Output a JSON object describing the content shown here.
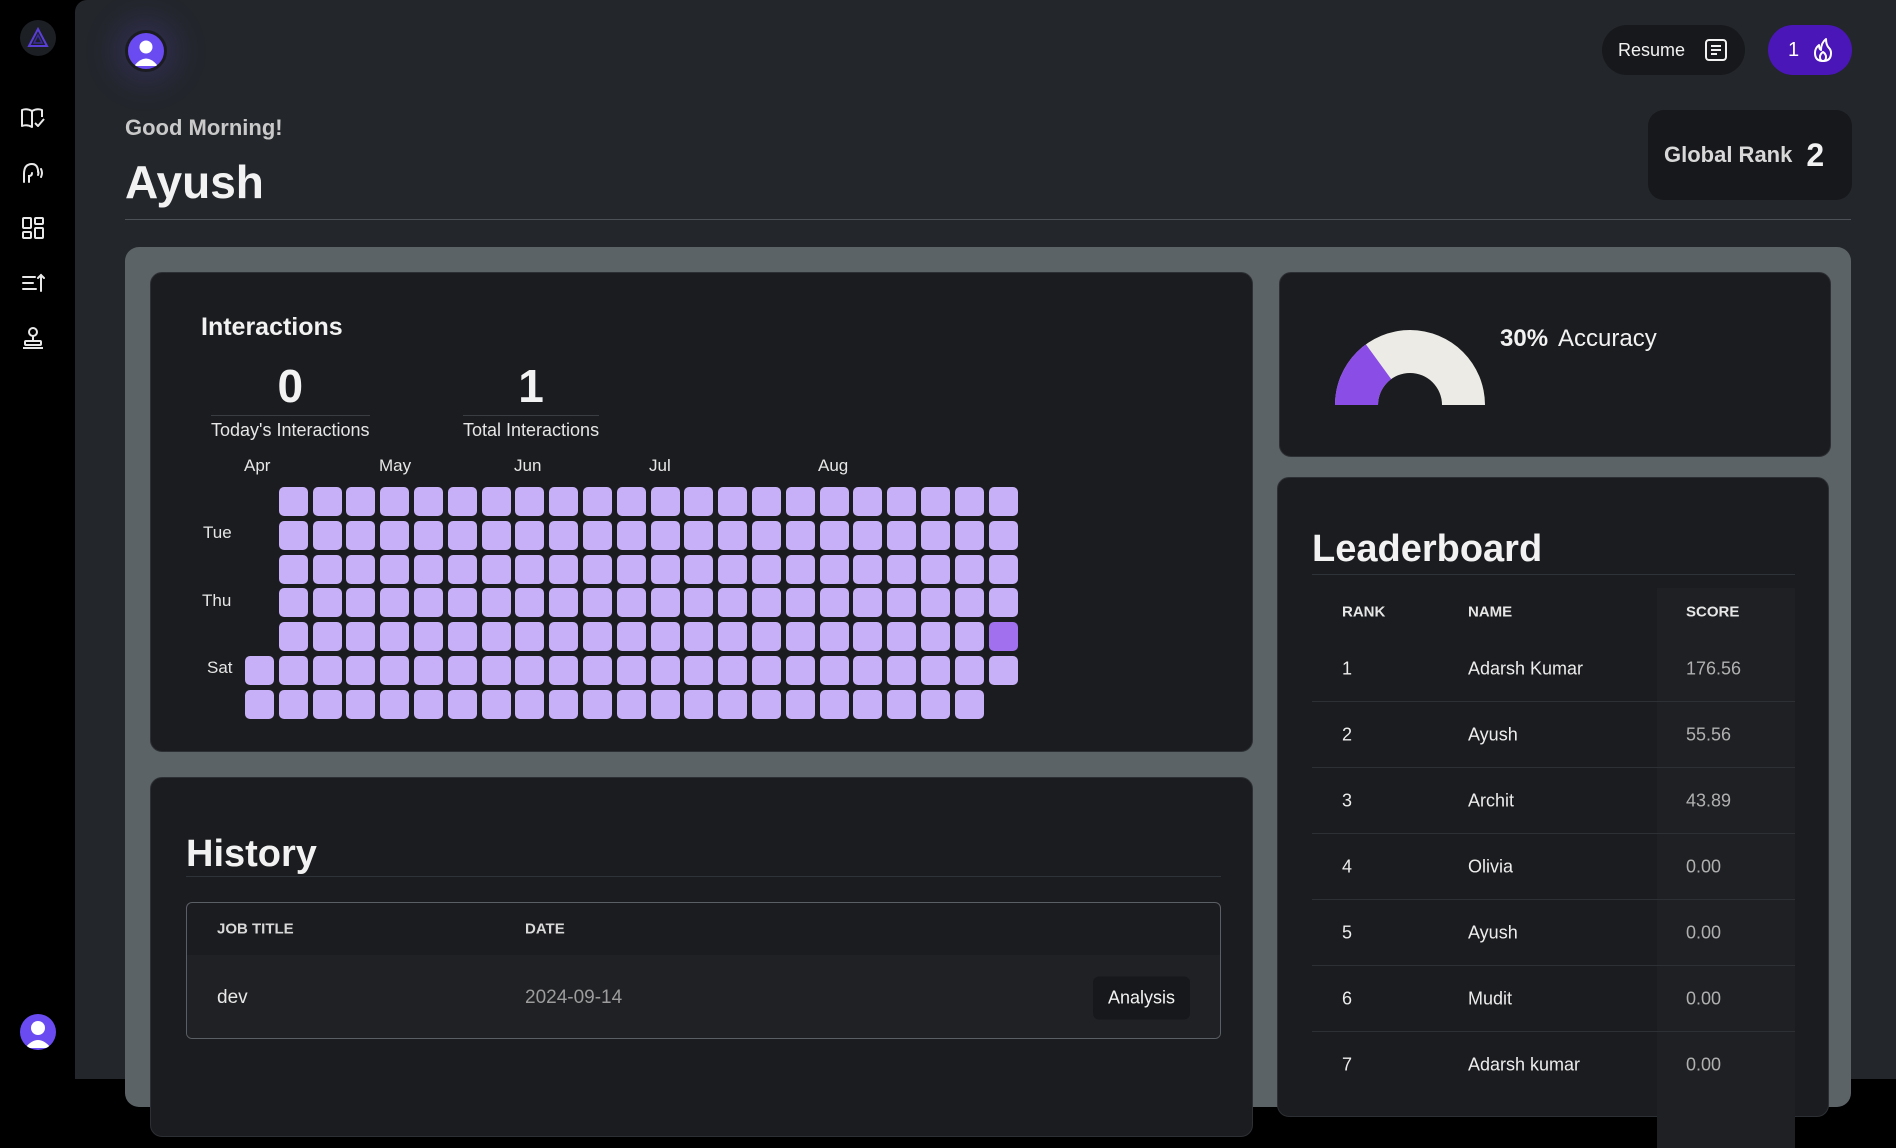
{
  "sidebar": {
    "logo_icon": "triangle-logo-icon",
    "items": [
      {
        "icon": "book-check-icon"
      },
      {
        "icon": "speaking-head-icon"
      },
      {
        "icon": "grid-dashboard-icon"
      },
      {
        "icon": "list-sort-icon"
      },
      {
        "icon": "person-stand-icon"
      }
    ]
  },
  "header": {
    "greeting": "Good Morning!",
    "username": "Ayush",
    "resume_label": "Resume",
    "streak_count": "1",
    "global_rank_label": "Global Rank",
    "global_rank_value": "2"
  },
  "interactions": {
    "title": "Interactions",
    "today_value": "0",
    "today_label": "Today's Interactions",
    "total_value": "1",
    "total_label": "Total Interactions",
    "months": [
      "Apr",
      "May",
      "Jun",
      "Jul",
      "Aug"
    ],
    "days": [
      "Tue",
      "Thu",
      "Sat"
    ],
    "heatmap": {
      "weeks": 23,
      "active_cell": {
        "week": 22,
        "day": 4
      },
      "colors": {
        "empty": "#c8b0f8",
        "active": "#a070ef"
      }
    }
  },
  "accuracy": {
    "percent": "30%",
    "label": "Accuracy",
    "value": 0.3,
    "colors": {
      "filled": "#8a4de6",
      "track": "#ecebe6"
    }
  },
  "leaderboard": {
    "title": "Leaderboard",
    "columns": [
      "RANK",
      "NAME",
      "SCORE"
    ],
    "rows": [
      {
        "rank": "1",
        "name": "Adarsh Kumar",
        "score": "176.56"
      },
      {
        "rank": "2",
        "name": "Ayush",
        "score": "55.56"
      },
      {
        "rank": "3",
        "name": "Archit",
        "score": "43.89"
      },
      {
        "rank": "4",
        "name": "Olivia",
        "score": "0.00"
      },
      {
        "rank": "5",
        "name": "Ayush",
        "score": "0.00"
      },
      {
        "rank": "6",
        "name": "Mudit",
        "score": "0.00"
      },
      {
        "rank": "7",
        "name": "Adarsh kumar",
        "score": "0.00"
      }
    ]
  },
  "history": {
    "title": "History",
    "columns": [
      "JOB TITLE",
      "DATE"
    ],
    "rows": [
      {
        "job_title": "dev",
        "date": "2024-09-14",
        "action": "Analysis"
      }
    ]
  },
  "colors": {
    "brand": "#4a16b8",
    "avatar": "#6a4bf2"
  }
}
